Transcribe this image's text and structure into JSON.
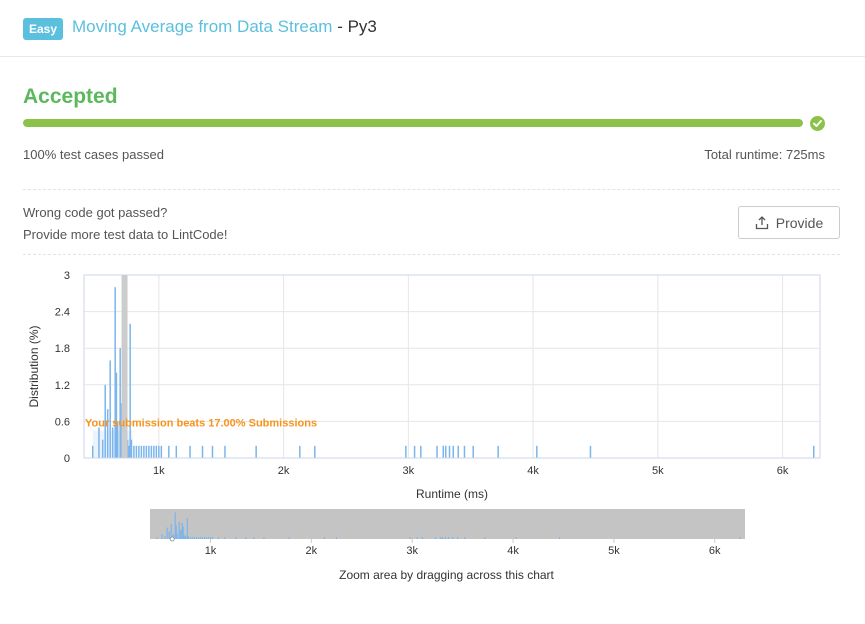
{
  "header": {
    "difficulty": "Easy",
    "problem_title": "Moving Average from Data Stream",
    "separator": " - ",
    "language": "Py3"
  },
  "result": {
    "status": "Accepted",
    "progress_percent": 100,
    "passed_label": "100%  test cases passed",
    "runtime_label": "Total runtime: 725ms"
  },
  "feedback": {
    "question": "Wrong code got passed?",
    "subtext": "Provide more test data to LintCode!",
    "provide_label": "Provide"
  },
  "colors": {
    "accent": "#5bc0de",
    "success": "#5cb85c",
    "progress": "#8bc34a",
    "bar": "#7cb5ec",
    "beats": "#f7941d"
  },
  "chart_data": [
    {
      "type": "bar",
      "xlabel": "Runtime (ms)",
      "ylabel": "Distribution (%)",
      "xlim": [
        400,
        6300
      ],
      "ylim": [
        0,
        3
      ],
      "x_ticks": [
        "1k",
        "2k",
        "3k",
        "4k",
        "5k",
        "6k"
      ],
      "y_ticks": [
        "0",
        "0.6",
        "1.2",
        "1.8",
        "2.4",
        "3"
      ],
      "annotation": "Your submission beats 17.00% Submissions",
      "your_runtime": 725,
      "points": [
        [
          470,
          0.2
        ],
        [
          520,
          0.5
        ],
        [
          550,
          0.3
        ],
        [
          570,
          1.2
        ],
        [
          590,
          0.8
        ],
        [
          610,
          1.6
        ],
        [
          630,
          0.5
        ],
        [
          650,
          2.8
        ],
        [
          660,
          1.4
        ],
        [
          670,
          0.6
        ],
        [
          690,
          1.8
        ],
        [
          700,
          0.9
        ],
        [
          710,
          1.0
        ],
        [
          720,
          1.7
        ],
        [
          730,
          1.3
        ],
        [
          740,
          0.4
        ],
        [
          750,
          0.3
        ],
        [
          760,
          0.2
        ],
        [
          770,
          2.2
        ],
        [
          780,
          0.3
        ],
        [
          800,
          0.2
        ],
        [
          820,
          0.2
        ],
        [
          840,
          0.2
        ],
        [
          860,
          0.2
        ],
        [
          880,
          0.2
        ],
        [
          900,
          0.2
        ],
        [
          920,
          0.2
        ],
        [
          940,
          0.2
        ],
        [
          960,
          0.2
        ],
        [
          980,
          0.2
        ],
        [
          1000,
          0.2
        ],
        [
          1020,
          0.2
        ],
        [
          1080,
          0.2
        ],
        [
          1140,
          0.2
        ],
        [
          1250,
          0.2
        ],
        [
          1350,
          0.2
        ],
        [
          1430,
          0.2
        ],
        [
          1530,
          0.2
        ],
        [
          1780,
          0.2
        ],
        [
          2130,
          0.2
        ],
        [
          2250,
          0.2
        ],
        [
          2980,
          0.2
        ],
        [
          3050,
          0.2
        ],
        [
          3100,
          0.2
        ],
        [
          3230,
          0.2
        ],
        [
          3280,
          0.2
        ],
        [
          3300,
          0.2
        ],
        [
          3330,
          0.2
        ],
        [
          3360,
          0.2
        ],
        [
          3400,
          0.2
        ],
        [
          3450,
          0.2
        ],
        [
          3520,
          0.2
        ],
        [
          3720,
          0.2
        ],
        [
          4030,
          0.2
        ],
        [
          4460,
          0.2
        ],
        [
          6250,
          0.2
        ]
      ]
    },
    {
      "type": "bar",
      "xlabel": "Zoom area by dragging across this chart",
      "xlim": [
        400,
        6300
      ],
      "x_ticks": [
        "1k",
        "2k",
        "3k",
        "4k",
        "5k",
        "6k"
      ]
    }
  ]
}
